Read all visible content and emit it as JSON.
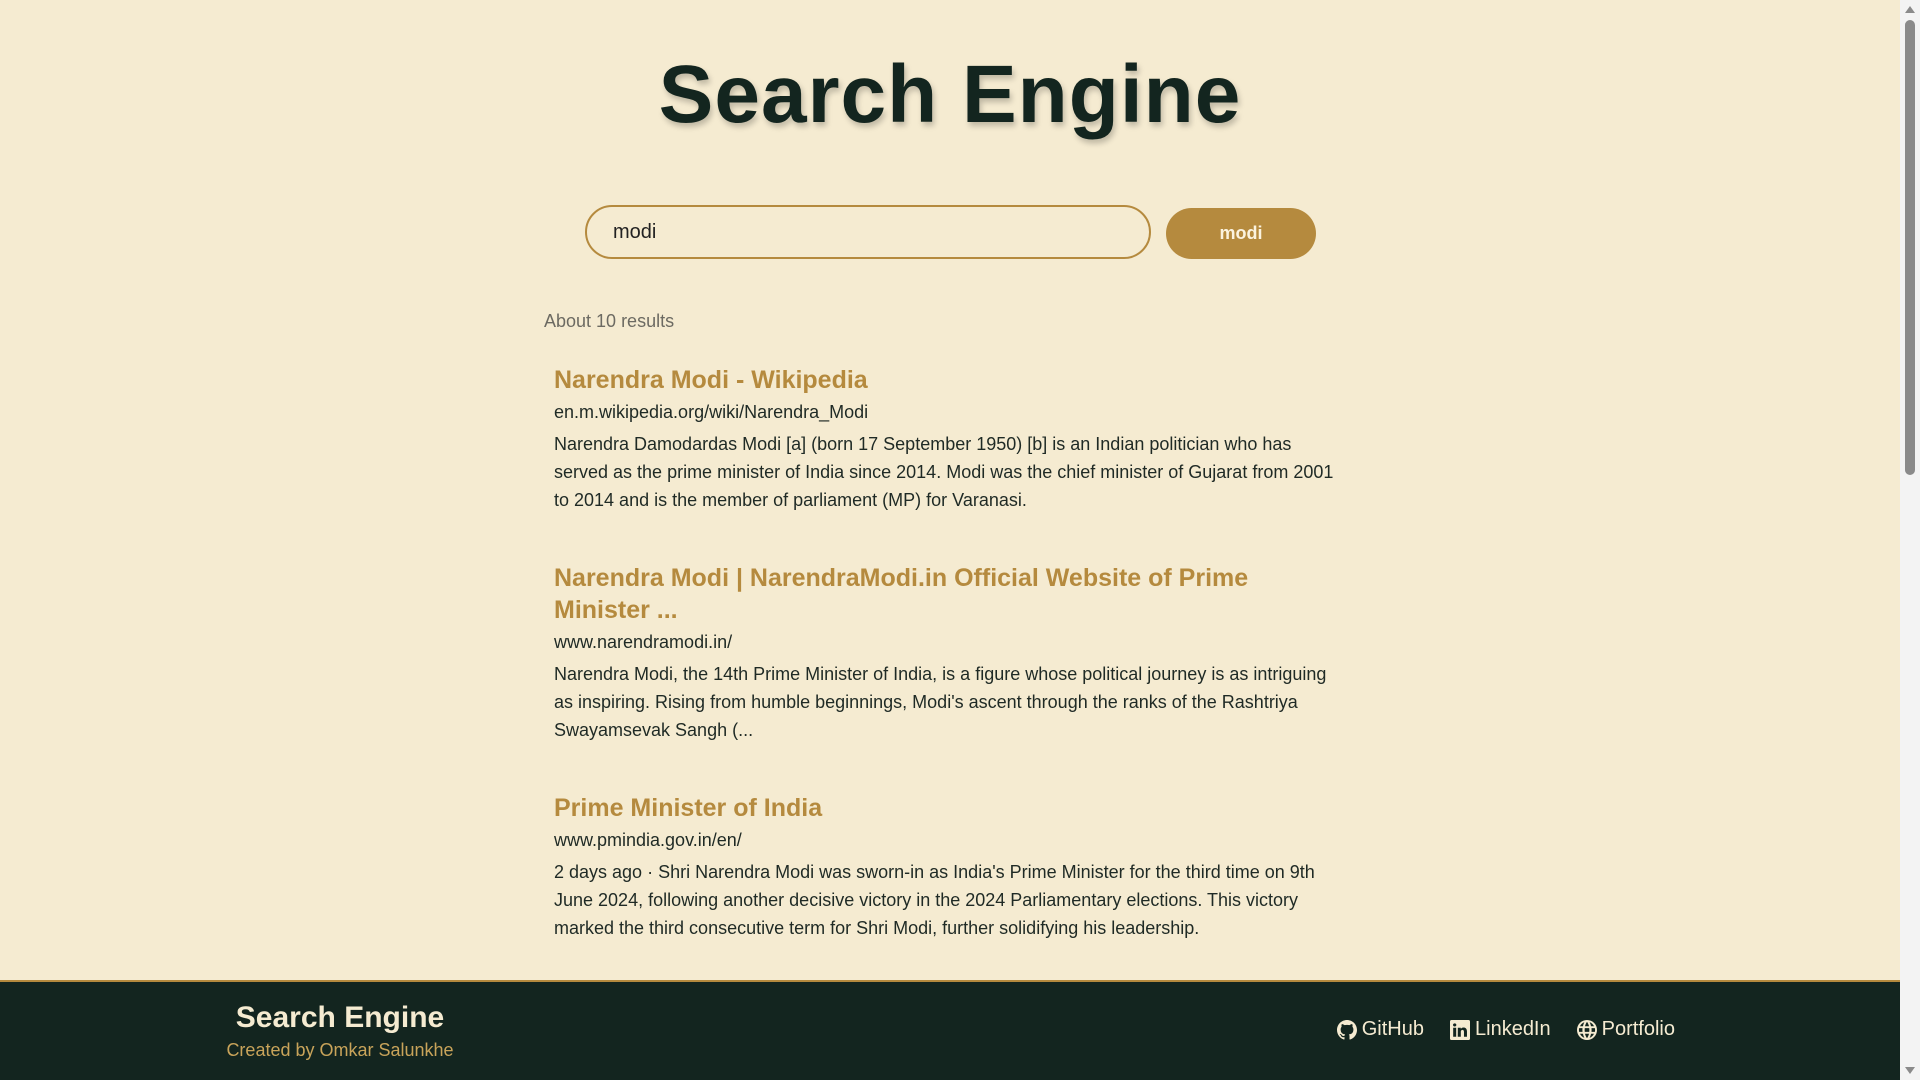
{
  "header": {
    "title": "Search Engine"
  },
  "search": {
    "value": "modi",
    "button_label": "modi"
  },
  "results_count": "About 10 results",
  "results": [
    {
      "title": "Narendra Modi - Wikipedia",
      "url": "en.m.wikipedia.org/wiki/Narendra_Modi",
      "snippet": "Narendra Damodardas Modi [a] (born 17 September 1950) [b] is an Indian politician who has served as the prime minister of India since 2014. Modi was the chief minister of Gujarat from 2001 to 2014 and is the member of parliament (MP) for Varanasi."
    },
    {
      "title": "Narendra Modi | NarendraModi.in Official Website of Prime Minister ...",
      "url": "www.narendramodi.in/",
      "snippet": "Narendra Modi, the 14th Prime Minister of India, is a figure whose political journey is as intriguing as inspiring. Rising from humble beginnings, Modi's ascent through the ranks of the Rashtriya Swayamsevak Sangh (..."
    },
    {
      "title": "Prime Minister of India",
      "url": "www.pmindia.gov.in/en/",
      "snippet": "2 days ago · Shri Narendra Modi was sworn-in as India's Prime Minister for the third time on 9th June 2024, following another decisive victory in the 2024 Parliamentary elections. This victory marked the third consecutive term for Shri Modi, further solidifying his leadership."
    }
  ],
  "footer": {
    "title": "Search Engine",
    "credit": "Created by Omkar Salunkhe",
    "links": [
      {
        "label": "GitHub",
        "icon": "github-icon"
      },
      {
        "label": "LinkedIn",
        "icon": "linkedin-icon"
      },
      {
        "label": "Portfolio",
        "icon": "globe-icon"
      }
    ]
  },
  "colors": {
    "background": "#f5ebd1",
    "accent": "#b58a3e",
    "dark": "#13251f"
  }
}
